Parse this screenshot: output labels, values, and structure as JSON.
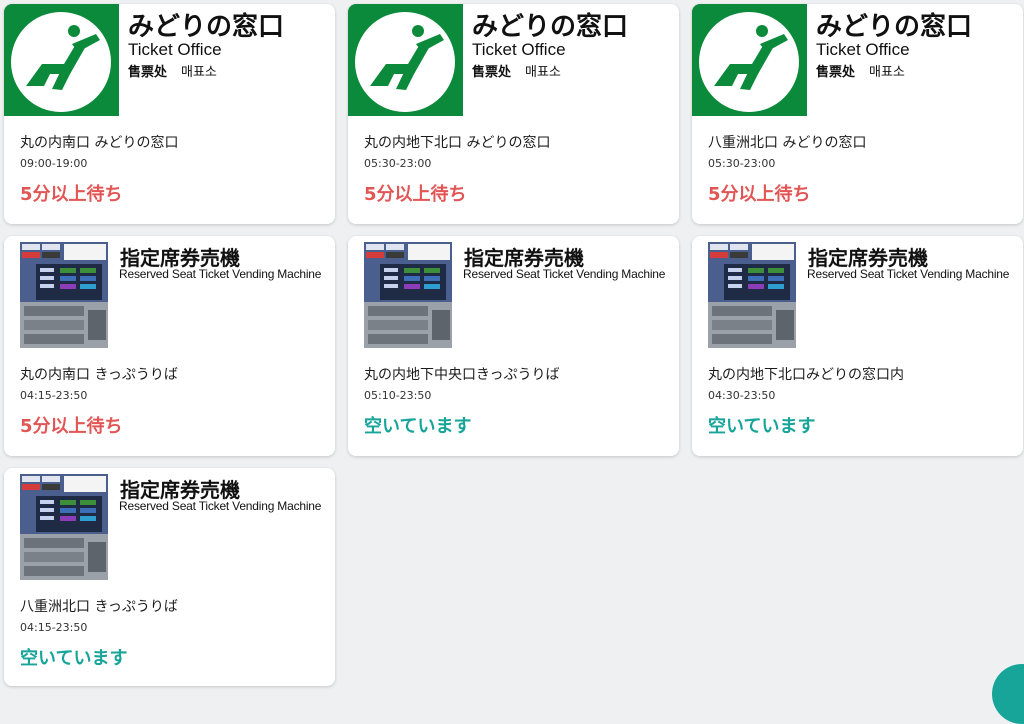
{
  "colors": {
    "busy": "#e25555",
    "available": "#17a59a",
    "midori_green": "#0a8a3a"
  },
  "cards": [
    {
      "type": "ticket-office",
      "icon": "seat-icon",
      "title_jp": "みどりの窓口",
      "title_en": "Ticket Office",
      "title_zh": "售票处",
      "title_ko": "매표소",
      "location": "丸の内南口 みどりの窓口",
      "hours": "09:00-19:00",
      "status": "5分以上待ち",
      "status_kind": "busy"
    },
    {
      "type": "ticket-office",
      "icon": "seat-icon",
      "title_jp": "みどりの窓口",
      "title_en": "Ticket Office",
      "title_zh": "售票处",
      "title_ko": "매표소",
      "location": "丸の内地下北口 みどりの窓口",
      "hours": "05:30-23:00",
      "status": "5分以上待ち",
      "status_kind": "busy"
    },
    {
      "type": "ticket-office",
      "icon": "seat-icon",
      "title_jp": "みどりの窓口",
      "title_en": "Ticket Office",
      "title_zh": "售票处",
      "title_ko": "매표소",
      "location": "八重洲北口 みどりの窓口",
      "hours": "05:30-23:00",
      "status": "5分以上待ち",
      "status_kind": "busy"
    },
    {
      "type": "vending-machine",
      "icon": "vending-machine-icon",
      "title_jp": "指定席券売機",
      "title_en": "Reserved Seat Ticket Vending Machine",
      "location": "丸の内南口 きっぷうりば",
      "hours": "04:15-23:50",
      "status": "5分以上待ち",
      "status_kind": "busy"
    },
    {
      "type": "vending-machine",
      "icon": "vending-machine-icon",
      "title_jp": "指定席券売機",
      "title_en": "Reserved Seat Ticket Vending Machine",
      "location": "丸の内地下中央口きっぷうりば",
      "hours": "05:10-23:50",
      "status": "空いています",
      "status_kind": "available"
    },
    {
      "type": "vending-machine",
      "icon": "vending-machine-icon",
      "title_jp": "指定席券売機",
      "title_en": "Reserved Seat Ticket Vending Machine",
      "location": "丸の内地下北口みどりの窓口内",
      "hours": "04:30-23:50",
      "status": "空いています",
      "status_kind": "available"
    },
    {
      "type": "vending-machine",
      "icon": "vending-machine-icon",
      "title_jp": "指定席券売機",
      "title_en": "Reserved Seat Ticket Vending Machine",
      "location": "八重洲北口 きっぷうりば",
      "hours": "04:15-23:50",
      "status": "空いています",
      "status_kind": "available"
    }
  ]
}
